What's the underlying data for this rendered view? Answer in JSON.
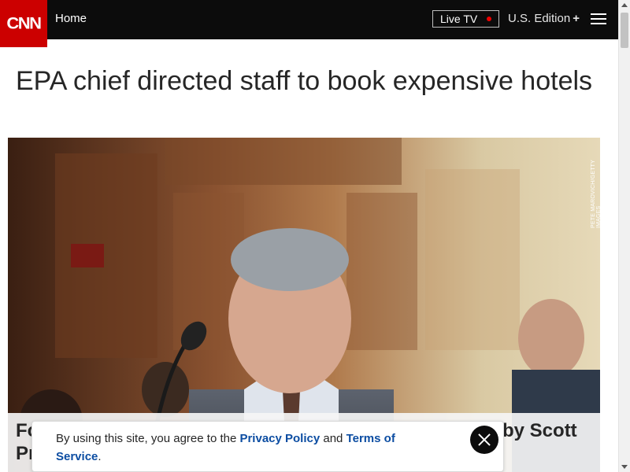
{
  "header": {
    "logo_text": "CNN",
    "home_label": "Home",
    "live_tv_label": "Live TV",
    "edition_label": "U.S. Edition",
    "edition_plus": "+",
    "colors": {
      "bar": "#0c0c0c",
      "logo": "#cc0000",
      "live_dot": "#ee0000"
    }
  },
  "article": {
    "headline": "EPA chief directed staff to book expensive hotels",
    "photo_credit": "PETE MAROVICH/GETTY IMAGES",
    "caption_left_1": "Fo",
    "caption_left_2": "Pr",
    "caption_right": "by Scott"
  },
  "cookie_notice": {
    "text_before": "By using this site, you agree to the ",
    "privacy_link": "Privacy Policy",
    "text_middle": " and ",
    "terms_link": "Terms of Service",
    "text_after": ".",
    "link_color": "#0c4da2"
  }
}
